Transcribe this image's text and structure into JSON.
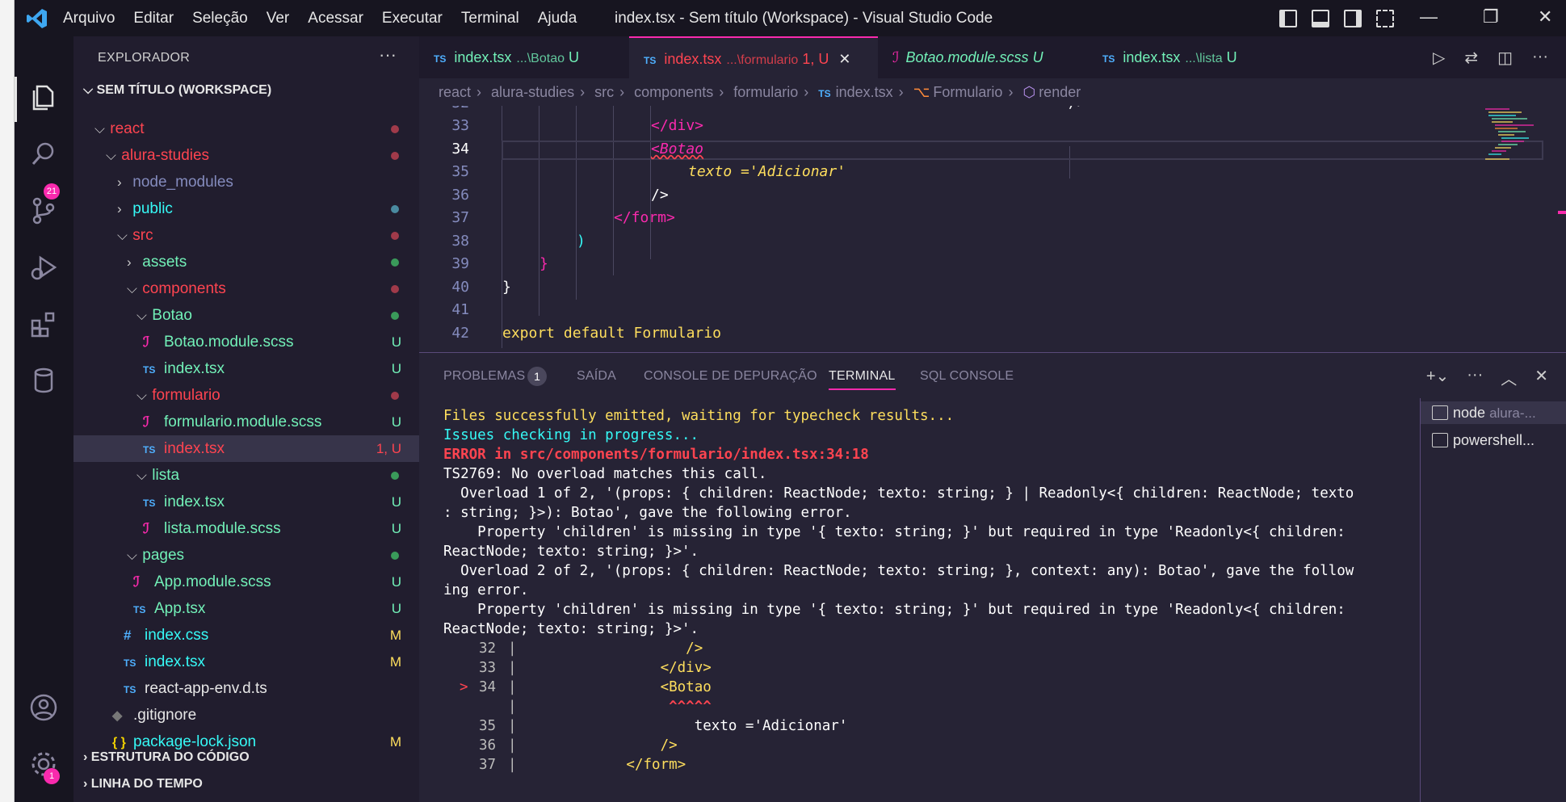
{
  "title_bar": {
    "menu": [
      "Arquivo",
      "Editar",
      "Seleção",
      "Ver",
      "Acessar",
      "Executar",
      "Terminal",
      "Ajuda"
    ],
    "window_title": "index.tsx - Sem título (Workspace) - Visual Studio Code"
  },
  "activity_bar": {
    "scm_badge": "21",
    "settings_badge": "1"
  },
  "sidebar": {
    "title": "EXPLORADOR",
    "workspace": "SEM TÍTULO (WORKSPACE)",
    "tree": [
      {
        "label": "react",
        "status": ""
      },
      {
        "label": "alura-studies",
        "status": ""
      },
      {
        "label": "node_modules",
        "status": ""
      },
      {
        "label": "public",
        "status": ""
      },
      {
        "label": "src",
        "status": ""
      },
      {
        "label": "assets",
        "status": ""
      },
      {
        "label": "components",
        "status": ""
      },
      {
        "label": "Botao",
        "status": ""
      },
      {
        "label": "Botao.module.scss",
        "status": "U"
      },
      {
        "label": "index.tsx",
        "status": "U"
      },
      {
        "label": "formulario",
        "status": ""
      },
      {
        "label": "formulario.module.scss",
        "status": "U"
      },
      {
        "label": "index.tsx",
        "status": "1, U"
      },
      {
        "label": "lista",
        "status": ""
      },
      {
        "label": "index.tsx",
        "status": "U"
      },
      {
        "label": "lista.module.scss",
        "status": "U"
      },
      {
        "label": "pages",
        "status": ""
      },
      {
        "label": "App.module.scss",
        "status": "U"
      },
      {
        "label": "App.tsx",
        "status": "U"
      },
      {
        "label": "index.css",
        "status": "M"
      },
      {
        "label": "index.tsx",
        "status": "M"
      },
      {
        "label": "react-app-env.d.ts",
        "status": ""
      },
      {
        "label": ".gitignore",
        "status": ""
      },
      {
        "label": "package-lock.json",
        "status": "M"
      }
    ],
    "file_icons": {
      "ts": "TS",
      "css": "#",
      "json": "{ }"
    },
    "sections": [
      "ESTRUTURA DO CÓDIGO",
      "LINHA DO TEMPO"
    ]
  },
  "tabs": [
    {
      "name": "index.tsx",
      "desc": "...\\Botao",
      "status": "U"
    },
    {
      "name": "index.tsx",
      "desc": "...\\formulario",
      "status": "1, U"
    },
    {
      "name": "Botao.module.scss",
      "desc": "",
      "status": "U"
    },
    {
      "name": "index.tsx",
      "desc": "...\\lista",
      "status": "U"
    }
  ],
  "breadcrumb": [
    "react",
    "alura-studies",
    "src",
    "components",
    "formulario",
    "index.tsx",
    "Formulario",
    "render"
  ],
  "editor": {
    "lines": [
      {
        "n": "32",
        "text": "/>"
      },
      {
        "n": "33",
        "text": "</div>"
      },
      {
        "n": "34",
        "text": "<Botao"
      },
      {
        "n": "35",
        "text": "texto ='Adicionar'"
      },
      {
        "n": "36",
        "text": "/>"
      },
      {
        "n": "37",
        "text": "</form>"
      },
      {
        "n": "38",
        "text": ")"
      },
      {
        "n": "39",
        "text": "}"
      },
      {
        "n": "40",
        "text": "}"
      },
      {
        "n": "41",
        "text": ""
      },
      {
        "n": "42",
        "text": "export default Formulario"
      }
    ]
  },
  "panel": {
    "tabs": [
      "PROBLEMAS",
      "SAÍDA",
      "CONSOLE DE DEPURAÇÃO",
      "TERMINAL",
      "SQL CONSOLE"
    ],
    "problems_count": "1",
    "terminal_lines": [
      "Files successfully emitted, waiting for typecheck results...",
      "Issues checking in progress...",
      "ERROR in src/components/formulario/index.tsx:34:18",
      "TS2769: No overload matches this call.",
      "  Overload 1 of 2, '(props: { children: ReactNode; texto: string; } | Readonly<{ children: ReactNode; texto",
      ": string; }>): Botao', gave the following error.",
      "    Property 'children' is missing in type '{ texto: string; }' but required in type 'Readonly<{ children:",
      "ReactNode; texto: string; }>'.",
      "  Overload 2 of 2, '(props: { children: ReactNode; texto: string; }, context: any): Botao', gave the follow",
      "ing error.",
      "    Property 'children' is missing in type '{ texto: string; }' but required in type 'Readonly<{ children:",
      "ReactNode; texto: string; }>'."
    ],
    "snippet": [
      {
        "mark": "",
        "n": "32",
        "code": "                   />"
      },
      {
        "mark": "",
        "n": "33",
        "code": "                </div>"
      },
      {
        "mark": ">",
        "n": "34",
        "code": "                <Botao"
      },
      {
        "mark": "",
        "n": "",
        "code": "                 ^^^^^"
      },
      {
        "mark": "",
        "n": "35",
        "code": "                    texto ='Adicionar'"
      },
      {
        "mark": "",
        "n": "36",
        "code": "                />"
      },
      {
        "mark": "",
        "n": "37",
        "code": "            </form>"
      }
    ],
    "terminals": [
      {
        "name": "node",
        "sub": "alura-..."
      },
      {
        "name": "powershell...",
        "sub": ""
      }
    ]
  }
}
